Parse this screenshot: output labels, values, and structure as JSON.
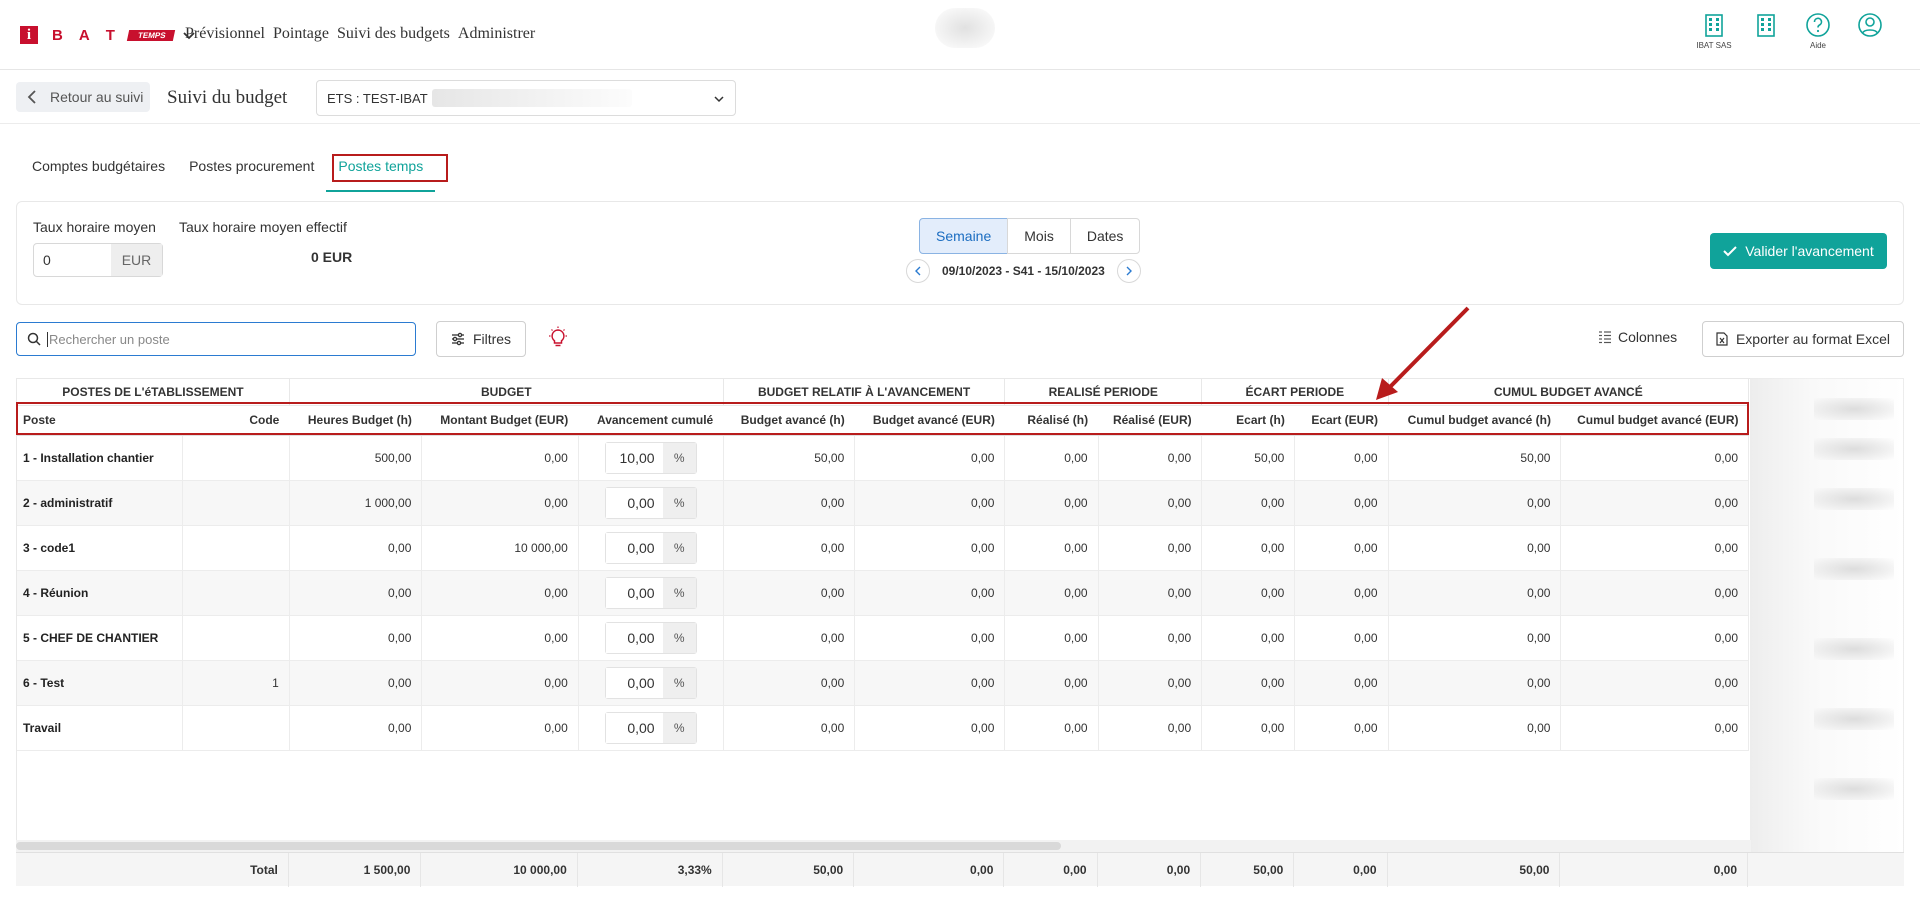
{
  "navbar": {
    "logo_i": "i",
    "logo_letters": [
      "B",
      "A",
      "T"
    ],
    "logo_badge": "TEMPS",
    "menu": [
      "Prévisionnel",
      "Pointage",
      "Suivi des budgets",
      "Administrer"
    ],
    "icons": [
      {
        "name": "building-icon",
        "caption": "IBAT SAS"
      },
      {
        "name": "building-icon",
        "caption": ""
      },
      {
        "name": "help-icon",
        "caption": "Aide"
      },
      {
        "name": "user-icon",
        "caption": ""
      }
    ]
  },
  "subheader": {
    "back_label": "Retour au suivi",
    "title": "Suivi du budget",
    "ets_value": "ETS : TEST-IBAT"
  },
  "tabs": [
    {
      "label": "Comptes budgétaires",
      "active": false
    },
    {
      "label": "Postes procurement",
      "active": false
    },
    {
      "label": "Postes temps",
      "active": true
    }
  ],
  "filters": {
    "rate_label": "Taux horaire moyen",
    "rate_value": "0",
    "rate_unit": "EUR",
    "eff_rate_label": "Taux horaire moyen effectif",
    "eff_rate_value": "0 EUR",
    "period_options": [
      "Semaine",
      "Mois",
      "Dates"
    ],
    "period_selected": "Semaine",
    "period_text": "09/10/2023 - S41 - 15/10/2023",
    "validate_label": "Valider l'avancement"
  },
  "toolbar": {
    "search_placeholder": "Rechercher un poste",
    "filters_label": "Filtres",
    "columns_label": "Colonnes",
    "export_label": "Exporter au format Excel"
  },
  "grid": {
    "groups": [
      "POSTES DE L'éTABLISSEMENT",
      "BUDGET",
      "BUDGET RELATIF À L'AVANCEMENT",
      "REALISÉ PERIODE",
      "ÉCART PERIODE",
      "CUMUL BUDGET AVANCÉ"
    ],
    "columns": [
      "Poste",
      "Code",
      "Heures Budget (h)",
      "Montant Budget (EUR)",
      "Avancement cumulé",
      "Budget avancé (h)",
      "Budget avancé (EUR)",
      "Réalisé (h)",
      "Réalisé (EUR)",
      "Ecart (h)",
      "Ecart (EUR)",
      "Cumul budget avancé (h)",
      "Cumul budget avancé (EUR)"
    ],
    "percent_unit": "%",
    "rows": [
      {
        "poste": "1 - Installation chantier",
        "code": "",
        "heures": "500,00",
        "montant": "0,00",
        "avancement": "10,00",
        "bav_h": "50,00",
        "bav_eur": "0,00",
        "real_h": "0,00",
        "real_eur": "0,00",
        "ecart_h": "50,00",
        "ecart_eur": "0,00",
        "cumul_h": "50,00",
        "cumul_eur": "0,00"
      },
      {
        "poste": "2 - administratif",
        "code": "",
        "heures": "1 000,00",
        "montant": "0,00",
        "avancement": "0,00",
        "bav_h": "0,00",
        "bav_eur": "0,00",
        "real_h": "0,00",
        "real_eur": "0,00",
        "ecart_h": "0,00",
        "ecart_eur": "0,00",
        "cumul_h": "0,00",
        "cumul_eur": "0,00"
      },
      {
        "poste": "3 - code1",
        "code": "",
        "heures": "0,00",
        "montant": "10 000,00",
        "avancement": "0,00",
        "bav_h": "0,00",
        "bav_eur": "0,00",
        "real_h": "0,00",
        "real_eur": "0,00",
        "ecart_h": "0,00",
        "ecart_eur": "0,00",
        "cumul_h": "0,00",
        "cumul_eur": "0,00"
      },
      {
        "poste": "4 - Réunion",
        "code": "",
        "heures": "0,00",
        "montant": "0,00",
        "avancement": "0,00",
        "bav_h": "0,00",
        "bav_eur": "0,00",
        "real_h": "0,00",
        "real_eur": "0,00",
        "ecart_h": "0,00",
        "ecart_eur": "0,00",
        "cumul_h": "0,00",
        "cumul_eur": "0,00"
      },
      {
        "poste": "5 - CHEF DE CHANTIER",
        "code": "",
        "heures": "0,00",
        "montant": "0,00",
        "avancement": "0,00",
        "bav_h": "0,00",
        "bav_eur": "0,00",
        "real_h": "0,00",
        "real_eur": "0,00",
        "ecart_h": "0,00",
        "ecart_eur": "0,00",
        "cumul_h": "0,00",
        "cumul_eur": "0,00"
      },
      {
        "poste": "6 - Test",
        "code": "1",
        "heures": "0,00",
        "montant": "0,00",
        "avancement": "0,00",
        "bav_h": "0,00",
        "bav_eur": "0,00",
        "real_h": "0,00",
        "real_eur": "0,00",
        "ecart_h": "0,00",
        "ecart_eur": "0,00",
        "cumul_h": "0,00",
        "cumul_eur": "0,00"
      },
      {
        "poste": "Travail",
        "code": "",
        "heures": "0,00",
        "montant": "0,00",
        "avancement": "0,00",
        "bav_h": "0,00",
        "bav_eur": "0,00",
        "real_h": "0,00",
        "real_eur": "0,00",
        "ecart_h": "0,00",
        "ecart_eur": "0,00",
        "cumul_h": "0,00",
        "cumul_eur": "0,00"
      }
    ],
    "total": {
      "label": "Total",
      "heures": "1 500,00",
      "montant": "10 000,00",
      "avancement": "3,33%",
      "bav_h": "50,00",
      "bav_eur": "0,00",
      "real_h": "0,00",
      "real_eur": "0,00",
      "ecart_h": "50,00",
      "ecart_eur": "0,00",
      "cumul_h": "50,00",
      "cumul_eur": "0,00"
    }
  },
  "colors": {
    "accent": "#10a39a",
    "brand": "#c8102e",
    "highlight": "#b81c1c",
    "selected": "#1b6dc1"
  }
}
